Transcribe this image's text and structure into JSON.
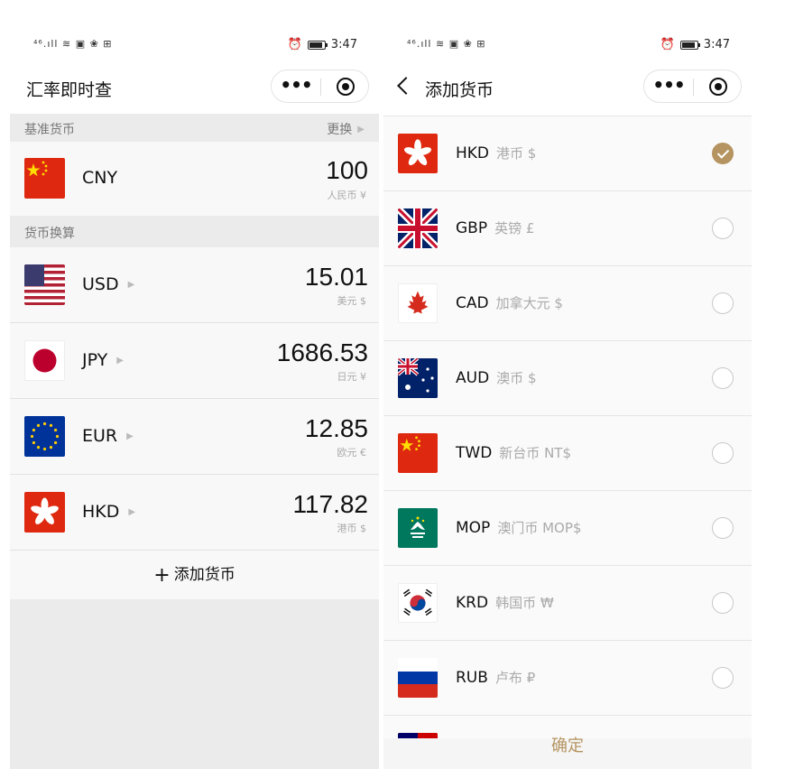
{
  "left": {
    "status_time": "3:47",
    "status_icons": "⁴⁶.ıll ≋ ▣ ❀ ⊞",
    "title": "汇率即时查",
    "capsule_more": "•••",
    "base_section": "基准货币",
    "swap_label": "更换",
    "base": {
      "code": "CNY",
      "amount": "100",
      "unit": "人民币 ¥",
      "flag": "cn-flag-icon"
    },
    "convert_section": "货币换算",
    "rates": [
      {
        "code": "USD",
        "amount": "15.01",
        "unit": "美元 $",
        "flag": "us-flag-icon"
      },
      {
        "code": "JPY",
        "amount": "1686.53",
        "unit": "日元 ¥",
        "flag": "jp-flag-icon"
      },
      {
        "code": "EUR",
        "amount": "12.85",
        "unit": "欧元 €",
        "flag": "eu-flag-icon"
      },
      {
        "code": "HKD",
        "amount": "117.82",
        "unit": "港币 $",
        "flag": "hk-flag-icon"
      }
    ],
    "add_label": "添加货币"
  },
  "right": {
    "status_time": "3:47",
    "status_icons": "⁴⁶.ıll ≋ ▣ ❀ ⊞",
    "title": "添加货币",
    "capsule_more": "•••",
    "currencies": [
      {
        "code": "HKD",
        "name": "港币 $",
        "checked": true,
        "flag": "hk-flag-icon"
      },
      {
        "code": "GBP",
        "name": "英镑 £",
        "checked": false,
        "flag": "uk-flag-icon"
      },
      {
        "code": "CAD",
        "name": "加拿大元 $",
        "checked": false,
        "flag": "ca-flag-icon"
      },
      {
        "code": "AUD",
        "name": "澳币 $",
        "checked": false,
        "flag": "au-flag-icon"
      },
      {
        "code": "TWD",
        "name": "新台币 NT$",
        "checked": false,
        "flag": "tw-flag-icon"
      },
      {
        "code": "MOP",
        "name": "澳门币 MOP$",
        "checked": false,
        "flag": "mo-flag-icon"
      },
      {
        "code": "KRD",
        "name": "韩国币 ₩",
        "checked": false,
        "flag": "kr-flag-icon"
      },
      {
        "code": "RUB",
        "name": "卢布 ₽",
        "checked": false,
        "flag": "ru-flag-icon"
      }
    ],
    "confirm_label": "确定"
  }
}
